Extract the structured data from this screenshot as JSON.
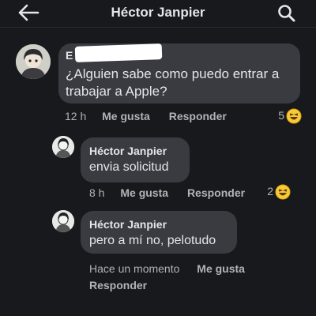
{
  "header": {
    "title": "Héctor Janpier",
    "back_icon": "arrow-left-icon",
    "search_icon": "search-icon"
  },
  "comments": [
    {
      "author_initial": "E",
      "text_line1": "¿Alguien sabe como puedo entrar a",
      "text_line2": "trabajar a Apple?",
      "time": "12 h",
      "like_label": "Me gusta",
      "reply_label": "Responder",
      "reaction_count": "5",
      "reaction_icon": "laughing-emoji-icon"
    },
    {
      "author": "Héctor Janpier",
      "text": "envia solicitud",
      "time": "8 h",
      "like_label": "Me gusta",
      "reply_label": "Responder",
      "reaction_count": "2",
      "reaction_icon": "laughing-emoji-icon"
    },
    {
      "author": "Héctor Janpier",
      "text": "pero a mí no, pelotudo",
      "time": "Hace un momento",
      "like_label": "Me gusta",
      "reply_label": "Responder"
    }
  ]
}
